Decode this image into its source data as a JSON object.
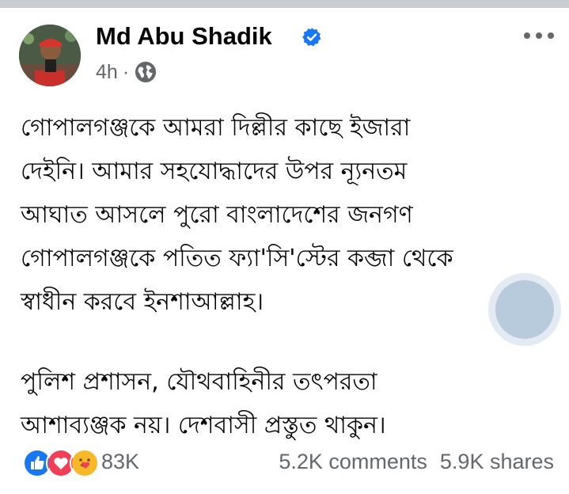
{
  "post": {
    "author": "Md Abu Shadik",
    "time": "4h",
    "separator": "·",
    "lines": [
      "গোপালগঞ্জকে আমরা দিল্লীর কাছে ইজারা",
      "দেইনি। আমার সহযোদ্ধাদের উপর ন্যূনতম",
      "আঘাত আসলে পুরো বাংলাদেশের জনগণ",
      "গোপালগঞ্জকে পতিত ফ্যা'সি'স্টের কব্জা থেকে",
      "স্বাধীন করবে ইনশাআল্লাহ।"
    ],
    "lines2": [
      "পুলিশ প্রশাসন, যৌথবাহিনীর তৎপরতা",
      "আশাব্যঞ্জক নয়। দেশবাসী প্রস্তুত থাকুন।"
    ]
  },
  "footer": {
    "reaction_count": "83K",
    "comments": "5.2K comments",
    "shares": "5.9K shares"
  },
  "icons": {
    "verified": "verified-badge-icon",
    "audience": "globe-icon",
    "more": "more-options-icon",
    "reactions": [
      "like-icon",
      "love-icon",
      "care-icon"
    ]
  },
  "colors": {
    "verified_blue": "#1877f2",
    "like_blue": "#1877f2",
    "love_red": "#f33e58",
    "care_yellow": "#f7b928",
    "secondary_text": "#65676b"
  }
}
